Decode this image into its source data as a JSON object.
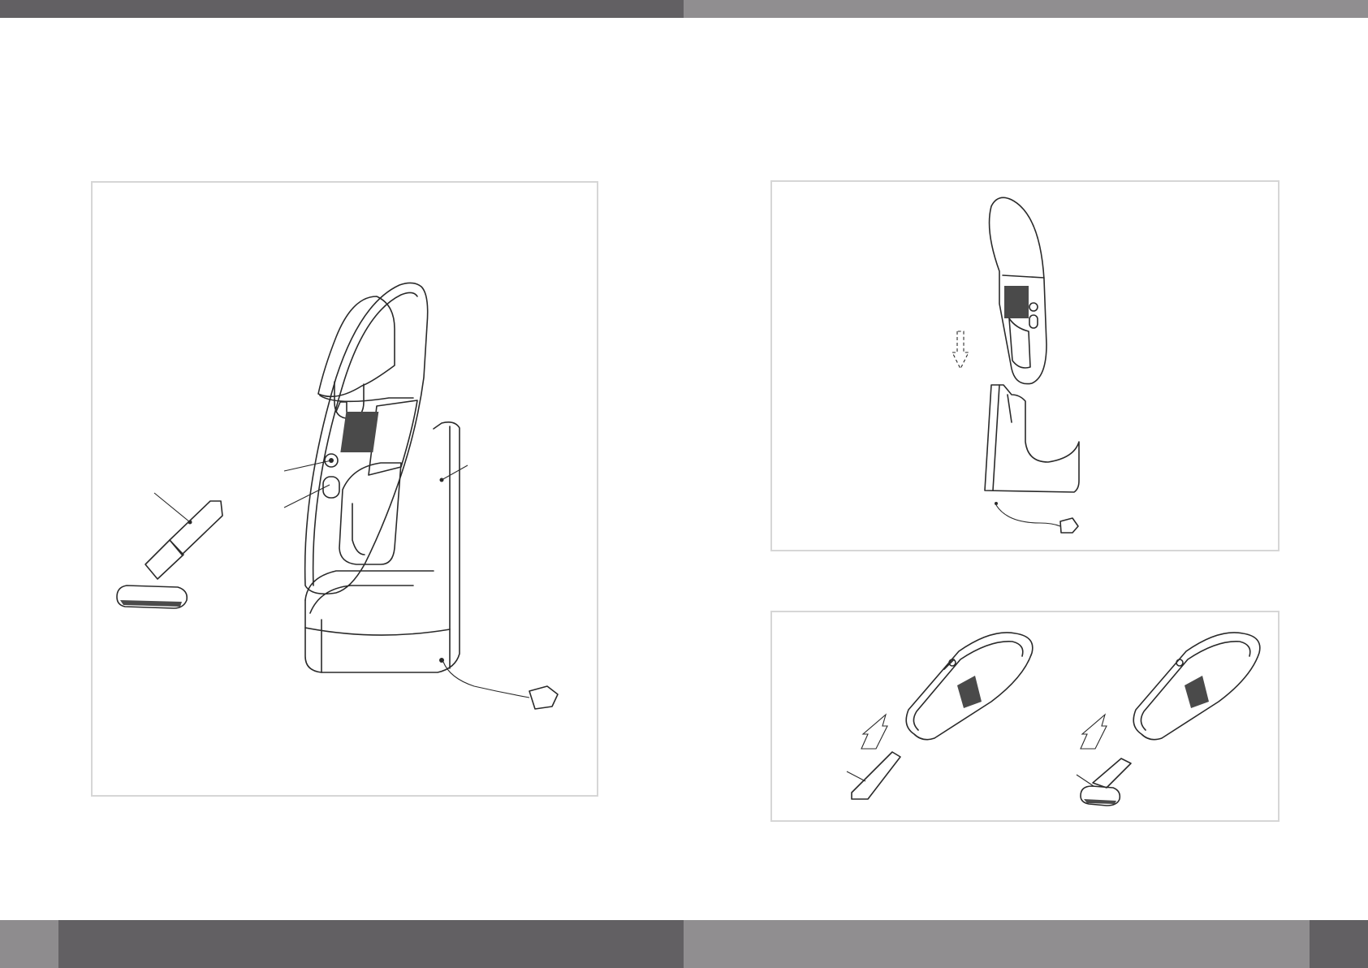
{
  "header": {
    "left_bar_color": "#626063",
    "right_bar_color": "#908e90"
  },
  "footer": {
    "left_bar_color": "#626063",
    "right_bar_color": "#908e90",
    "left_tab_color": "#8e8c8e",
    "right_tab_color": "#626063"
  },
  "panels": {
    "main": {
      "illustration": "handheld-vacuum-on-charging-base",
      "callouts": [
        "on-off-switch-callout",
        "release-button-callout",
        "charging-base-callout",
        "brush-attachment-callout"
      ]
    },
    "dock": {
      "illustration": "placing-vacuum-onto-charging-base",
      "arrow": "down-arrow-icon"
    },
    "attach": {
      "illustrations": [
        "fitting-crevice-tool",
        "fitting-brush-tool"
      ],
      "arrows": [
        "up-right-arrow-icon",
        "up-right-arrow-icon"
      ]
    }
  }
}
